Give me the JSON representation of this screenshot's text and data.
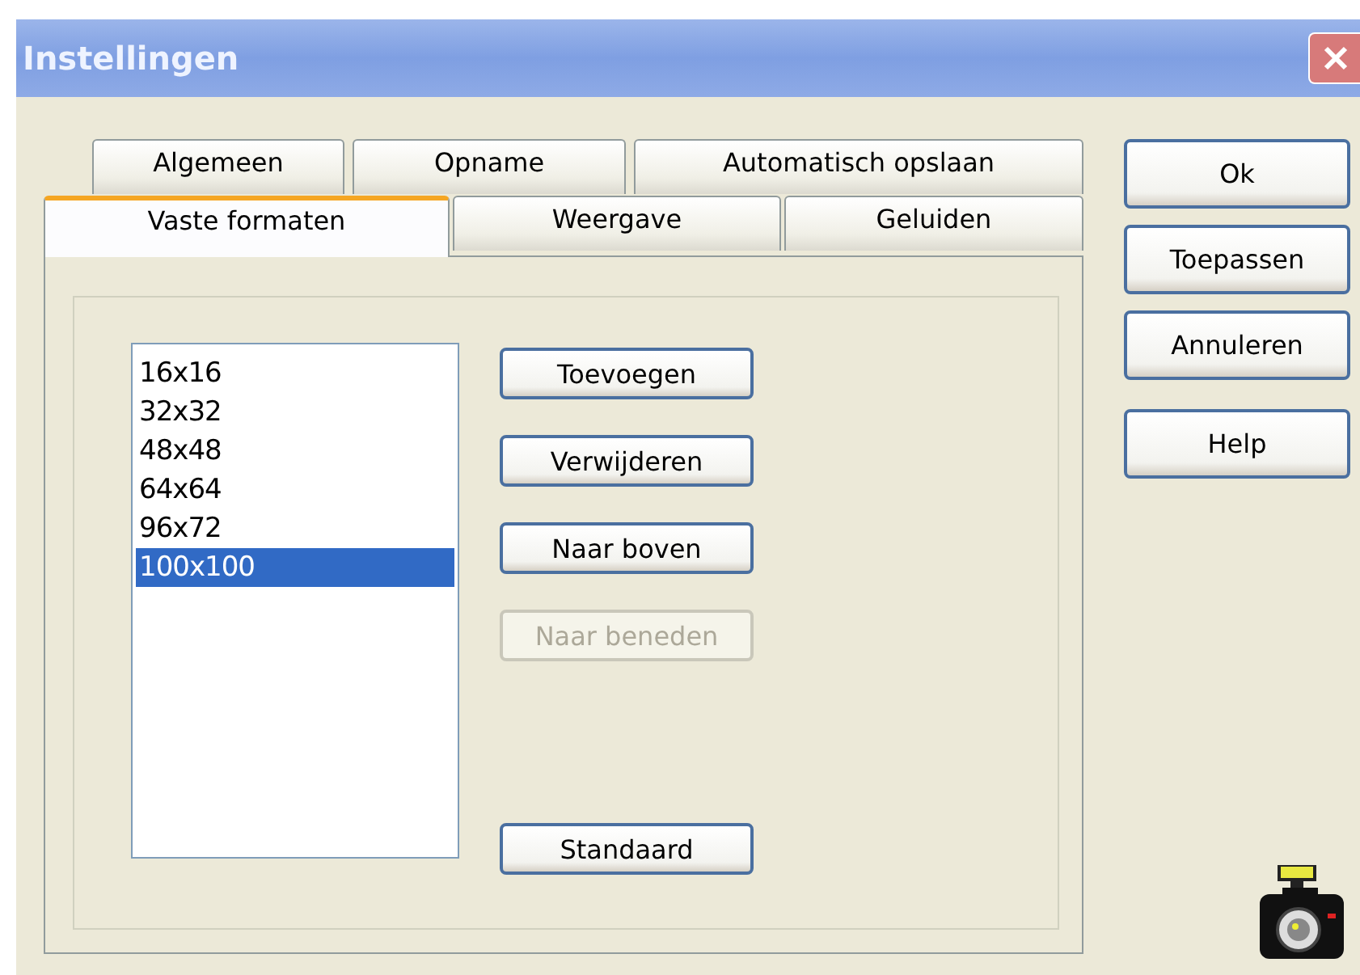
{
  "window": {
    "title": "Instellingen"
  },
  "tab_rows": [
    [
      {
        "label": "Algemeen",
        "selected": false
      },
      {
        "label": "Opname",
        "selected": false
      },
      {
        "label": "Automatisch opslaan",
        "selected": false
      }
    ],
    [
      {
        "label": "Vaste formaten",
        "selected": true
      },
      {
        "label": "Weergave",
        "selected": false
      },
      {
        "label": "Geluiden",
        "selected": false
      }
    ]
  ],
  "formats": [
    {
      "label": "16x16",
      "selected": false
    },
    {
      "label": "32x32",
      "selected": false
    },
    {
      "label": "48x48",
      "selected": false
    },
    {
      "label": "64x64",
      "selected": false
    },
    {
      "label": "96x72",
      "selected": false
    },
    {
      "label": "100x100",
      "selected": true
    }
  ],
  "list_buttons": [
    {
      "label": "Toevoegen",
      "disabled": false
    },
    {
      "label": "Verwijderen",
      "disabled": false
    },
    {
      "label": "Naar boven",
      "disabled": false
    },
    {
      "label": "Naar beneden",
      "disabled": true
    },
    {
      "label": "Standaard",
      "disabled": false
    }
  ],
  "dialog_buttons": [
    "Ok",
    "Toepassen",
    "Annuleren",
    "Help"
  ]
}
